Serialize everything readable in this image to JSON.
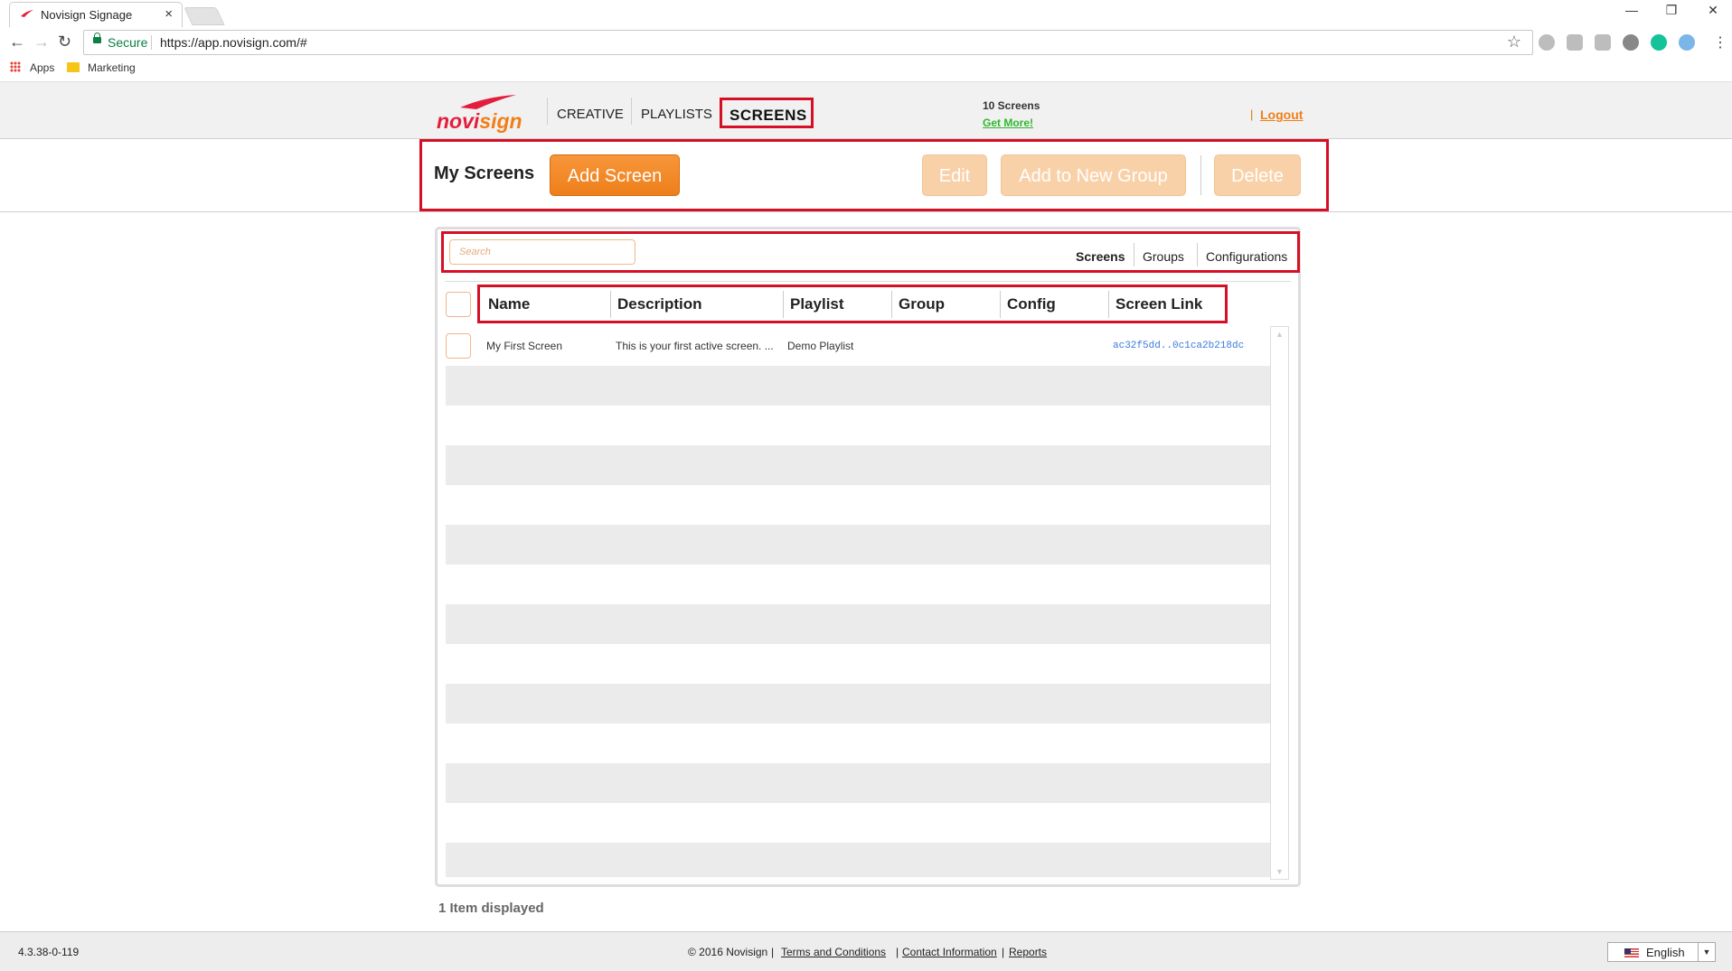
{
  "browser": {
    "tab_title": "Novisign Signage",
    "tab_close": "×",
    "secure_label": "Secure",
    "url": "https://app.novisign.com/#",
    "bookmarks": [
      "Apps",
      "Marketing"
    ]
  },
  "header": {
    "logo": {
      "part1": "novi",
      "part2": "sign"
    },
    "nav": [
      "CREATIVE",
      "PLAYLISTS",
      "SCREENS"
    ],
    "screen_count": "10 Screens",
    "get_more": "Get More!",
    "separator": "|",
    "logout": "Logout"
  },
  "toolbar": {
    "title": "My Screens",
    "add_screen": "Add Screen",
    "edit": "Edit",
    "add_to_group": "Add to New Group",
    "delete": "Delete"
  },
  "filter": {
    "search_placeholder": "Search",
    "tabs": [
      "Screens",
      "Groups",
      "Configurations"
    ],
    "active_tab": "Screens"
  },
  "table": {
    "columns": [
      "Name",
      "Description",
      "Playlist",
      "Group",
      "Config",
      "Screen Link"
    ],
    "rows": [
      {
        "name": "My First Screen",
        "description": "This is your first active screen. ...",
        "playlist": "Demo Playlist",
        "group": "",
        "config": "",
        "screen_link": "ac32f5dd..0c1ca2b218dc"
      }
    ]
  },
  "status": {
    "items_displayed": "1 Item displayed"
  },
  "footer": {
    "version": "4.3.38-0-119",
    "copyright": "© 2016 Novisign",
    "links": [
      "Terms and Conditions",
      "Contact Information",
      "Reports"
    ],
    "language": "English"
  },
  "colors": {
    "accent": "#f07f19",
    "brand_red": "#e31e3c",
    "highlight": "#d50f25",
    "link_green": "#2fb82f"
  }
}
